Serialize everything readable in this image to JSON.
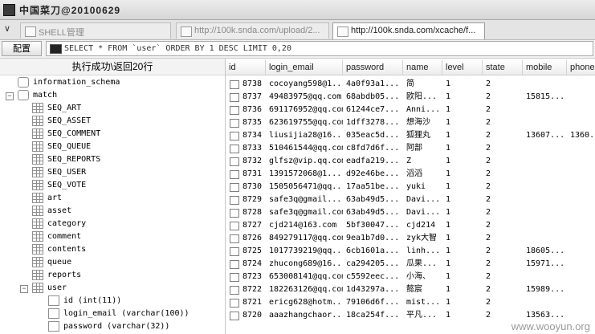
{
  "window": {
    "title": "中国菜刀@20100629"
  },
  "tabs": [
    {
      "label": "SHELL管理"
    },
    {
      "label": "http://100k.snda.com/upload/2..."
    },
    {
      "label": "http://100k.snda.com/xcache/f..."
    }
  ],
  "toolbar": {
    "config_label": "配置",
    "sql_query": "SELECT * FROM `user` ORDER BY 1 DESC LIMIT 0,20"
  },
  "status": {
    "message": "执行成功\\返回20行"
  },
  "tree": {
    "items": [
      {
        "label": "information_schema",
        "type": "database",
        "level": 0,
        "toggle": ""
      },
      {
        "label": "match",
        "type": "database",
        "level": 0,
        "toggle": "−"
      },
      {
        "label": "SEQ_ART",
        "type": "table",
        "level": 1,
        "toggle": ""
      },
      {
        "label": "SEQ_ASSET",
        "type": "table",
        "level": 1,
        "toggle": ""
      },
      {
        "label": "SEQ_COMMENT",
        "type": "table",
        "level": 1,
        "toggle": ""
      },
      {
        "label": "SEQ_QUEUE",
        "type": "table",
        "level": 1,
        "toggle": ""
      },
      {
        "label": "SEQ_REPORTS",
        "type": "table",
        "level": 1,
        "toggle": ""
      },
      {
        "label": "SEQ_USER",
        "type": "table",
        "level": 1,
        "toggle": ""
      },
      {
        "label": "SEQ_VOTE",
        "type": "table",
        "level": 1,
        "toggle": ""
      },
      {
        "label": "art",
        "type": "table",
        "level": 1,
        "toggle": ""
      },
      {
        "label": "asset",
        "type": "table",
        "level": 1,
        "toggle": ""
      },
      {
        "label": "category",
        "type": "table",
        "level": 1,
        "toggle": ""
      },
      {
        "label": "comment",
        "type": "table",
        "level": 1,
        "toggle": ""
      },
      {
        "label": "contents",
        "type": "table",
        "level": 1,
        "toggle": ""
      },
      {
        "label": "queue",
        "type": "table",
        "level": 1,
        "toggle": ""
      },
      {
        "label": "reports",
        "type": "table",
        "level": 1,
        "toggle": ""
      },
      {
        "label": "user",
        "type": "table",
        "level": 1,
        "toggle": "−"
      },
      {
        "label": "id (int(11))",
        "type": "column",
        "level": 2,
        "toggle": ""
      },
      {
        "label": "login_email (varchar(100))",
        "type": "column",
        "level": 2,
        "toggle": ""
      },
      {
        "label": "password (varchar(32))",
        "type": "column",
        "level": 2,
        "toggle": ""
      }
    ]
  },
  "grid": {
    "columns": [
      "id",
      "login_email",
      "password",
      "name",
      "level",
      "state",
      "mobile",
      "phone"
    ],
    "rows": [
      [
        "8738",
        "cocoyang598@1...",
        "4a0f93a1...",
        "简",
        "1",
        "2",
        "",
        ""
      ],
      [
        "8737",
        "49483975@qq.com",
        "68abdb05...",
        "欧阳...",
        "1",
        "2",
        "15815...",
        ""
      ],
      [
        "8736",
        "691176952@qq.com",
        "61244ce7...",
        "Anni...",
        "1",
        "2",
        "",
        ""
      ],
      [
        "8735",
        "623619755@qq.com",
        "1dff3278...",
        "想海沙",
        "1",
        "2",
        "",
        ""
      ],
      [
        "8734",
        "liusijia28@16...",
        "035eac5d...",
        "狐狸丸",
        "1",
        "2",
        "13607...",
        "1360..."
      ],
      [
        "8733",
        "510461544@qq.com",
        "c8fd7d6f...",
        "阿部",
        "1",
        "2",
        "",
        ""
      ],
      [
        "8732",
        "glfsz@vip.qq.com",
        "eadfa219...",
        "Z",
        "1",
        "2",
        "",
        ""
      ],
      [
        "8731",
        "1391572068@1...",
        "d92e46be...",
        "滔滔",
        "1",
        "2",
        "",
        ""
      ],
      [
        "8730",
        "1505056471@qq...",
        "17aa51be...",
        "yuki",
        "1",
        "2",
        "",
        ""
      ],
      [
        "8729",
        "safe3q@gmail....",
        "63ab49d5...",
        "Davi...",
        "1",
        "2",
        "",
        ""
      ],
      [
        "8728",
        "safe3q@gmail.com",
        "63ab49d5...",
        "Davi...",
        "1",
        "2",
        "",
        ""
      ],
      [
        "8727",
        "cjd214@163.com",
        "5bf30047...",
        "cjd214",
        "1",
        "2",
        "",
        ""
      ],
      [
        "8726",
        "849279117@qq.com",
        "9ea1b7d0...",
        "zyk大智",
        "1",
        "2",
        "",
        ""
      ],
      [
        "8725",
        "1017739219@qq...",
        "6cb1601a...",
        "linh...",
        "1",
        "2",
        "18605...",
        ""
      ],
      [
        "8724",
        "zhucong689@16...",
        "ca294205...",
        "瓜果...",
        "1",
        "2",
        "15971...",
        ""
      ],
      [
        "8723",
        "653008141@qq.com",
        "c5592eec...",
        "小海、",
        "1",
        "2",
        "",
        ""
      ],
      [
        "8722",
        "182263126@qq.com",
        "1d43297a...",
        "懿宸",
        "1",
        "2",
        "15989...",
        ""
      ],
      [
        "8721",
        "ericg628@hotm...",
        "79106d6f...",
        "mist...",
        "1",
        "2",
        "",
        ""
      ],
      [
        "8720",
        "aaazhangchaor...",
        "18ca254f...",
        "平凡...",
        "1",
        "2",
        "13563...",
        ""
      ]
    ]
  },
  "watermark": "www.wooyun.org"
}
